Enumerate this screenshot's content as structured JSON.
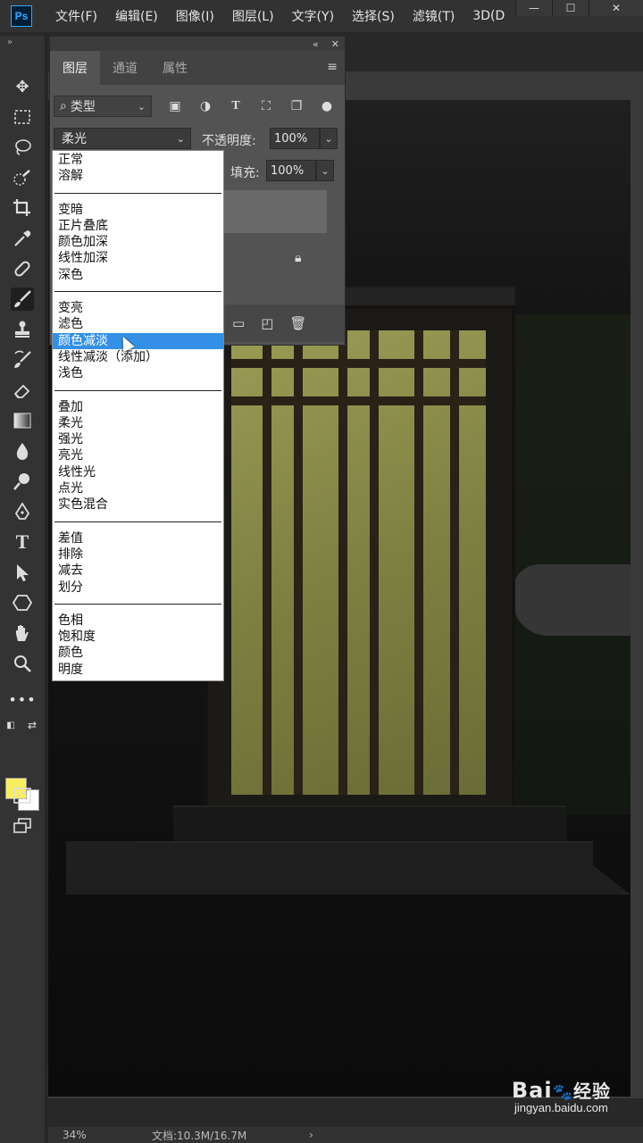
{
  "app": {
    "logo": "Ps"
  },
  "menu": [
    "文件(F)",
    "编辑(E)",
    "图像(I)",
    "图层(L)",
    "文字(Y)",
    "选择(S)",
    "滤镜(T)",
    "3D(D"
  ],
  "window_controls": {
    "minimize": "—",
    "maximize": "☐",
    "close": "✕"
  },
  "panel": {
    "tabs": [
      "图层",
      "通道",
      "属性"
    ],
    "filter_kind": "类型",
    "blend_mode": "柔光",
    "opacity_label": "不透明度:",
    "opacity_value": "100%",
    "fill_label": "填充:",
    "fill_value": "100%"
  },
  "blend_menu": {
    "groups": [
      [
        "正常",
        "溶解"
      ],
      [
        "变暗",
        "正片叠底",
        "颜色加深",
        "线性加深",
        "深色"
      ],
      [
        "变亮",
        "滤色",
        "颜色减淡",
        "线性减淡（添加）",
        "浅色"
      ],
      [
        "叠加",
        "柔光",
        "强光",
        "亮光",
        "线性光",
        "点光",
        "实色混合"
      ],
      [
        "差值",
        "排除",
        "减去",
        "划分"
      ],
      [
        "色相",
        "饱和度",
        "颜色",
        "明度"
      ]
    ],
    "highlighted": "颜色减淡"
  },
  "colors": {
    "foreground": "#f9ee62",
    "background": "#ffffff",
    "highlight": "#3390e6"
  },
  "status": {
    "zoom": "34%",
    "doc": "文档:10.3M/16.7M"
  },
  "watermark": {
    "logo": "Bai",
    "logo_suffix": "经验",
    "url": "jingyan.baidu.com"
  }
}
